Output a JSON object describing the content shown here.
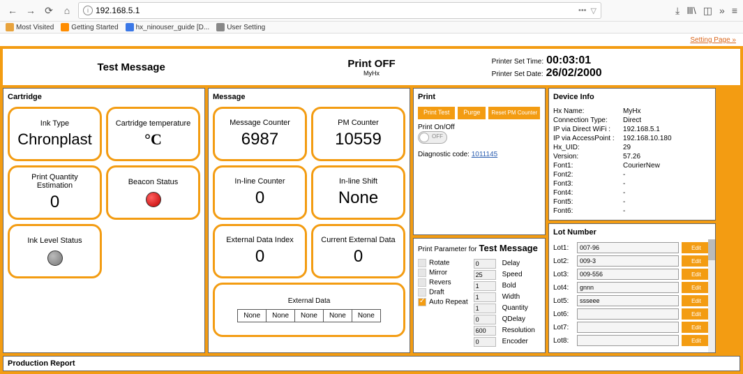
{
  "browser": {
    "url": "192.168.5.1",
    "bookmarks": [
      "Most Visited",
      "Getting Started",
      "hx_ninouser_guide [D...",
      "User Setting"
    ]
  },
  "setting_link": "Setting Page »",
  "header": {
    "message_title": "Test Message",
    "print_status": "Print OFF",
    "subtitle": "MyHx",
    "time_label": "Printer Set Time:",
    "time_value": "00:03:01",
    "date_label": "Printer Set Date:",
    "date_value": "26/02/2000"
  },
  "cartridge": {
    "title": "Cartridge",
    "tiles": {
      "ink_type": {
        "label": "Ink Type",
        "value": "Chronplast"
      },
      "temp": {
        "label": "Cartridge temperature",
        "value": "°C"
      },
      "pq": {
        "label": "Print Quantity Estimation",
        "value": "0"
      },
      "beacon": {
        "label": "Beacon Status"
      },
      "ink_level": {
        "label": "Ink Level Status"
      }
    }
  },
  "message_panel": {
    "title": "Message",
    "tiles": {
      "mc": {
        "label": "Message Counter",
        "value": "6987"
      },
      "pm": {
        "label": "PM Counter",
        "value": "10559"
      },
      "ilc": {
        "label": "In-line Counter",
        "value": "0"
      },
      "ils": {
        "label": "In-line Shift",
        "value": "None"
      },
      "edi": {
        "label": "External Data Index",
        "value": "0"
      },
      "ced": {
        "label": "Current External Data",
        "value": "0"
      }
    },
    "extdata": {
      "title": "External Data",
      "cells": [
        "None",
        "None",
        "None",
        "None",
        "None"
      ]
    }
  },
  "print": {
    "title": "Print",
    "buttons": {
      "print_test": "Print Test",
      "purge": "Purge",
      "reset_pm": "Reset PM Counter"
    },
    "onoff_label": "Print On/Off",
    "onoff_state": "OFF",
    "diag_label": "Diagnostic code:",
    "diag_code": "1011145"
  },
  "pp": {
    "title_prefix": "Print Parameter for",
    "msg_name": "Test Message",
    "opts": [
      {
        "name": "Rotate",
        "checked": false
      },
      {
        "name": "Mirror",
        "checked": false
      },
      {
        "name": "Revers",
        "checked": false
      },
      {
        "name": "Draft",
        "checked": false
      },
      {
        "name": "Auto Repeat",
        "checked": true
      }
    ],
    "params": [
      {
        "val": "0",
        "name": "Delay"
      },
      {
        "val": "25",
        "name": "Speed"
      },
      {
        "val": "1",
        "name": "Bold"
      },
      {
        "val": "1",
        "name": "Width"
      },
      {
        "val": "1",
        "name": "Quantity"
      },
      {
        "val": "0",
        "name": "QDelay"
      },
      {
        "val": "600",
        "name": "Resolution"
      },
      {
        "val": "0",
        "name": "Encoder"
      }
    ]
  },
  "device": {
    "title": "Device Info",
    "rows": [
      {
        "k": "Hx Name:",
        "v": "MyHx"
      },
      {
        "k": "Connection Type:",
        "v": "Direct"
      },
      {
        "k": "IP via Direct WiFi :",
        "v": "192.168.5.1"
      },
      {
        "k": "IP via AccessPoint :",
        "v": "192.168.10.180"
      },
      {
        "k": "Hx_UID:",
        "v": "29"
      },
      {
        "k": "Version:",
        "v": "57.26"
      },
      {
        "k": "Font1:",
        "v": "CourierNew"
      },
      {
        "k": "Font2:",
        "v": "-"
      },
      {
        "k": "Font3:",
        "v": "-"
      },
      {
        "k": "Font4:",
        "v": "-"
      },
      {
        "k": "Font5:",
        "v": "-"
      },
      {
        "k": "Font6:",
        "v": "-"
      }
    ]
  },
  "lot": {
    "title": "Lot Number",
    "edit_label": "Edit",
    "rows": [
      {
        "label": "Lot1:",
        "value": "007-96"
      },
      {
        "label": "Lot2:",
        "value": "009-3"
      },
      {
        "label": "Lot3:",
        "value": "009-556"
      },
      {
        "label": "Lot4:",
        "value": "gnnn"
      },
      {
        "label": "Lot5:",
        "value": "ssseee"
      },
      {
        "label": "Lot6:",
        "value": ""
      },
      {
        "label": "Lot7:",
        "value": ""
      },
      {
        "label": "Lot8:",
        "value": ""
      }
    ]
  },
  "prod_report": "Production Report"
}
